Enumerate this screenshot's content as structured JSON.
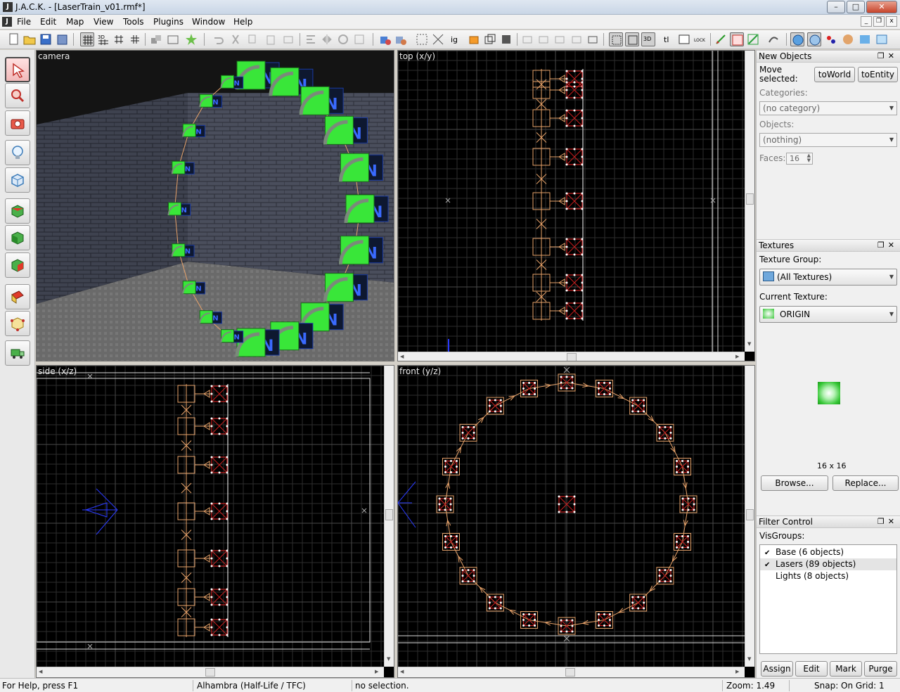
{
  "window": {
    "title": "J.A.C.K. - [LaserTrain_v01.rmf*]",
    "app_icon": "J",
    "controls": {
      "minimize": "–",
      "maximize": "□",
      "close": "✕"
    },
    "mdi_controls": {
      "minimize": "_",
      "restore": "❐",
      "close": "x"
    }
  },
  "menu": {
    "items": [
      "File",
      "Edit",
      "Map",
      "View",
      "Tools",
      "Plugins",
      "Window",
      "Help"
    ]
  },
  "viewports": {
    "camera": {
      "label": "camera"
    },
    "top": {
      "label": "top (x/y)"
    },
    "side": {
      "label": "side (x/z)"
    },
    "front": {
      "label": "front (y/z)"
    }
  },
  "panels": {
    "new_objects": {
      "title": "New Objects",
      "move_label": "Move selected:",
      "to_world": "toWorld",
      "to_entity": "toEntity",
      "categories_label": "Categories:",
      "categories_value": "(no category)",
      "objects_label": "Objects:",
      "objects_value": "(nothing)",
      "faces_label": "Faces:",
      "faces_value": "16"
    },
    "textures": {
      "title": "Textures",
      "group_label": "Texture Group:",
      "group_value": "(All Textures)",
      "current_label": "Current Texture:",
      "current_value": "ORIGIN",
      "size": "16 x 16",
      "browse": "Browse...",
      "replace": "Replace..."
    },
    "filter": {
      "title": "Filter Control",
      "visgroups_label": "VisGroups:",
      "items": [
        "Base (6 objects)",
        "Lasers (89 objects)",
        "Lights (8 objects)"
      ],
      "assign": "Assign",
      "edit": "Edit",
      "mark": "Mark",
      "purge": "Purge"
    }
  },
  "status": {
    "help": "For Help, press F1",
    "game": "Alhambra (Half-Life / TFC)",
    "selection": "no selection.",
    "zoom": "Zoom: 1.49",
    "snap": "Snap: On Grid: 1"
  },
  "colors": {
    "grid_minor": "#2e2e2e",
    "grid_major": "#4a4a4a",
    "path": "#e8a36a",
    "entity": "#c81e1e",
    "laser_green": "#39e639"
  }
}
